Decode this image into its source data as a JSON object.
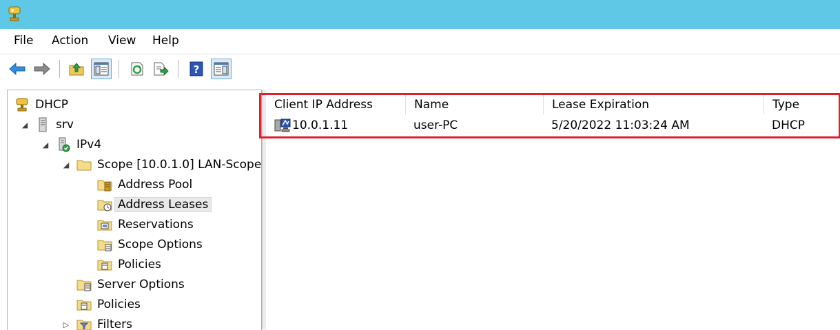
{
  "menu": {
    "file": "File",
    "action": "Action",
    "view": "View",
    "help": "Help"
  },
  "toolbar": {
    "back": "back-arrow-icon",
    "forward": "forward-arrow-icon",
    "up": "up-folder-icon",
    "show_hide_tree": "console-tree-icon",
    "refresh": "refresh-icon",
    "export": "export-list-icon",
    "help": "help-icon",
    "show_action_pane": "action-pane-icon"
  },
  "tree": {
    "root": "DHCP",
    "server": "srv",
    "ipv4": "IPv4",
    "scope": "Scope [10.0.1.0] LAN-Scope",
    "address_pool": "Address Pool",
    "address_leases": "Address Leases",
    "reservations": "Reservations",
    "scope_options": "Scope Options",
    "scope_policies": "Policies",
    "server_options": "Server Options",
    "policies": "Policies",
    "filters": "Filters"
  },
  "list": {
    "columns": {
      "client_ip": "Client IP Address",
      "name": "Name",
      "lease_expiration": "Lease Expiration",
      "type": "Type"
    },
    "rows": [
      {
        "client_ip": "10.0.1.11",
        "name": "user-PC",
        "lease_expiration": "5/20/2022 11:03:24 AM",
        "type": "DHCP"
      }
    ]
  },
  "colors": {
    "titlebar": "#5ec8e6",
    "highlight": "#e0202a",
    "pressed": "#d8ebfa"
  }
}
